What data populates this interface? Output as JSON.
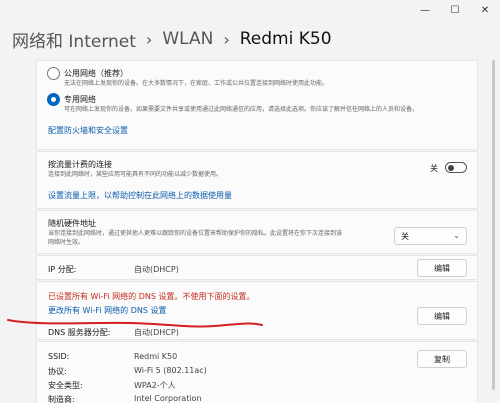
{
  "window": {
    "minimize_glyph": "—",
    "maximize_glyph": "☐",
    "close_glyph": "✕"
  },
  "breadcrumb": {
    "items": [
      "网络和 Internet",
      "WLAN"
    ],
    "separator": "›",
    "current": "Redmi K50"
  },
  "network_profile": {
    "public": {
      "label": "公用网络（推荐）",
      "desc": "无法在网络上发现你的设备。在大多数情况下，在家庭、工作或公共位置连接到网络时使用此功能。",
      "checked": false
    },
    "private": {
      "label": "专用网络",
      "desc": "可在网络上发现你的设备。如果需要文件共享或使用通过此网络通信的应用，请选择此选项。你应该了解并信任网络上的人员和设备。",
      "checked": true
    },
    "firewall_link": "配置防火墙和安全设置"
  },
  "metered": {
    "label": "按流量计费的连接",
    "desc": "连接到此网络时，某些应用可能具有不同的功能以减少数据使用。",
    "toggle_label": "关",
    "toggle_on": false,
    "data_limit_link": "设置流量上限，以帮助控制在此网络上的数据使用量"
  },
  "random_hw": {
    "label": "随机硬件地址",
    "desc_line1": "当你连接到此网络时，通过使其他人更难以跟踪你的设备位置来帮助保护你的隐私。此设置将在你下次连接到该",
    "desc_line2": "网络时生效。",
    "value": "关",
    "chevron": "⌄"
  },
  "ip": {
    "label": "IP 分配:",
    "value": "自动(DHCP)",
    "edit": "编辑"
  },
  "dns": {
    "warning": "已设置所有 Wi-Fi 网络的 DNS 设置。不使用下面的设置。",
    "change_link": "更改所有 Wi-Fi 网络的 DNS 设置",
    "label": "DNS 服务器分配:",
    "value": "自动(DHCP)",
    "edit": "编辑"
  },
  "properties": {
    "copy": "复制",
    "rows": [
      {
        "key": "SSID:",
        "value": "Redmi K50"
      },
      {
        "key": "协议:",
        "value": "Wi-Fi 5 (802.11ac)"
      },
      {
        "key": "安全类型:",
        "value": "WPA2-个人"
      },
      {
        "key": "制造商:",
        "value": "Intel Corporation"
      }
    ]
  },
  "colors": {
    "accent": "#0067c0",
    "link": "#0b5cad",
    "warning": "#c42b1c",
    "annotation_stroke": "#d42020"
  }
}
